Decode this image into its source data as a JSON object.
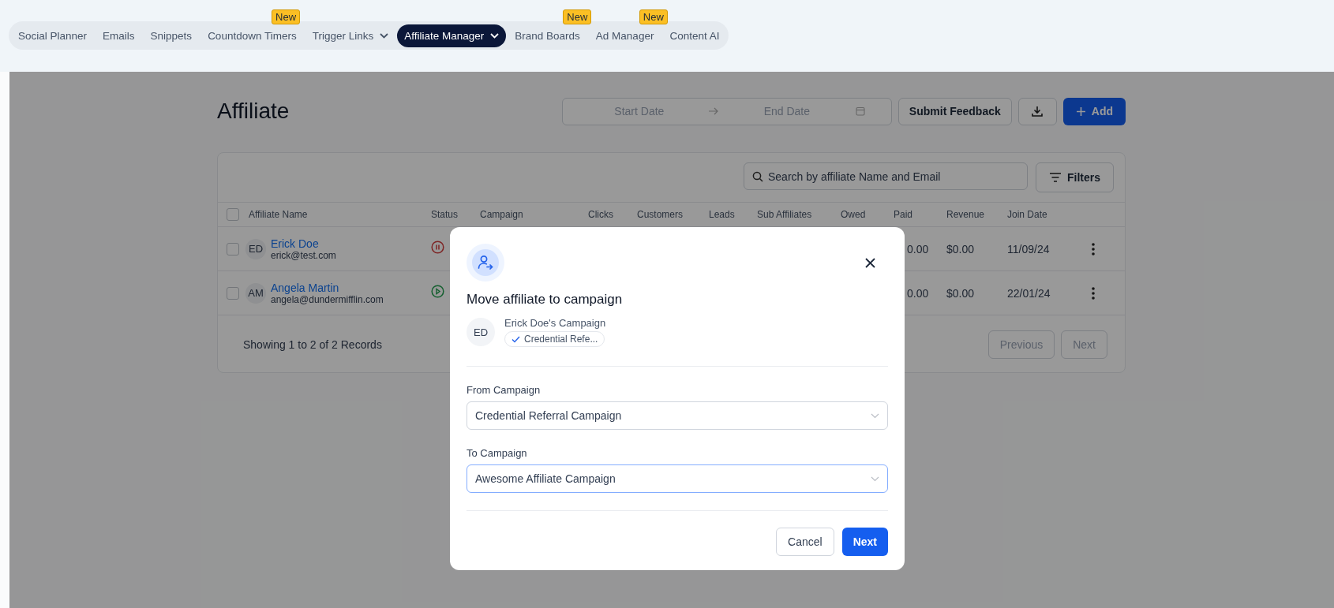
{
  "nav": {
    "items": [
      {
        "label": "Social Planner",
        "selected": false,
        "dropdown": false
      },
      {
        "label": "Emails",
        "selected": false,
        "dropdown": false
      },
      {
        "label": "Snippets",
        "selected": false,
        "dropdown": false
      },
      {
        "label": "Countdown Timers",
        "selected": false,
        "badge": "New",
        "dropdown": false
      },
      {
        "label": "Trigger Links",
        "selected": false,
        "dropdown": true
      },
      {
        "label": "Affiliate Manager",
        "selected": true,
        "dropdown": true
      },
      {
        "label": "Brand Boards",
        "selected": false,
        "badge": "New",
        "dropdown": false
      },
      {
        "label": "Ad Manager",
        "selected": false,
        "badge": "New",
        "dropdown": false
      },
      {
        "label": "Content AI",
        "selected": false,
        "dropdown": false
      }
    ]
  },
  "page": {
    "title": "Affiliate",
    "date_range": {
      "start_placeholder": "Start Date",
      "end_placeholder": "End Date"
    },
    "buttons": {
      "feedback": "Submit Feedback",
      "add": "Add"
    }
  },
  "table": {
    "search": {
      "placeholder": "Search by affiliate Name and Email"
    },
    "filters": "Filters",
    "select_all": {
      "checked": false
    },
    "columns": [
      "Affiliate Name",
      "Status",
      "Campaign",
      "Clicks",
      "Customers",
      "Leads",
      "Sub Affiliates",
      "Owed",
      "Paid",
      "Revenue",
      "Join Date"
    ],
    "rows": [
      {
        "checked": false,
        "initials": "ED",
        "name": "Erick Doe",
        "email": "erick@test.com",
        "kind": "paused",
        "paid": "0.00",
        "revenue": "$0.00",
        "join_date": "11/09/24"
      },
      {
        "checked": false,
        "initials": "AM",
        "name": "Angela Martin",
        "email": "angela@dundermifflin.com",
        "kind": "active",
        "paid": "0.00",
        "revenue": "$0.00",
        "join_date": "22/01/24"
      }
    ],
    "footer": "Showing 1 to 2 of 2 Records",
    "pagination": {
      "previous": "Previous",
      "next": "Next"
    }
  },
  "modal": {
    "title": "Move affiliate to campaign",
    "affiliate": {
      "initials": "ED",
      "campaign_name": "Erick Doe's Campaign",
      "tag": "Credential Refe..."
    },
    "from": {
      "label": "From Campaign",
      "value": "Credential Referral Campaign",
      "focused": false
    },
    "to": {
      "label": "To Campaign",
      "value": "Awesome Affiliate Campaign",
      "focused": true
    },
    "buttons": {
      "cancel": "Cancel",
      "next": "Next"
    }
  }
}
